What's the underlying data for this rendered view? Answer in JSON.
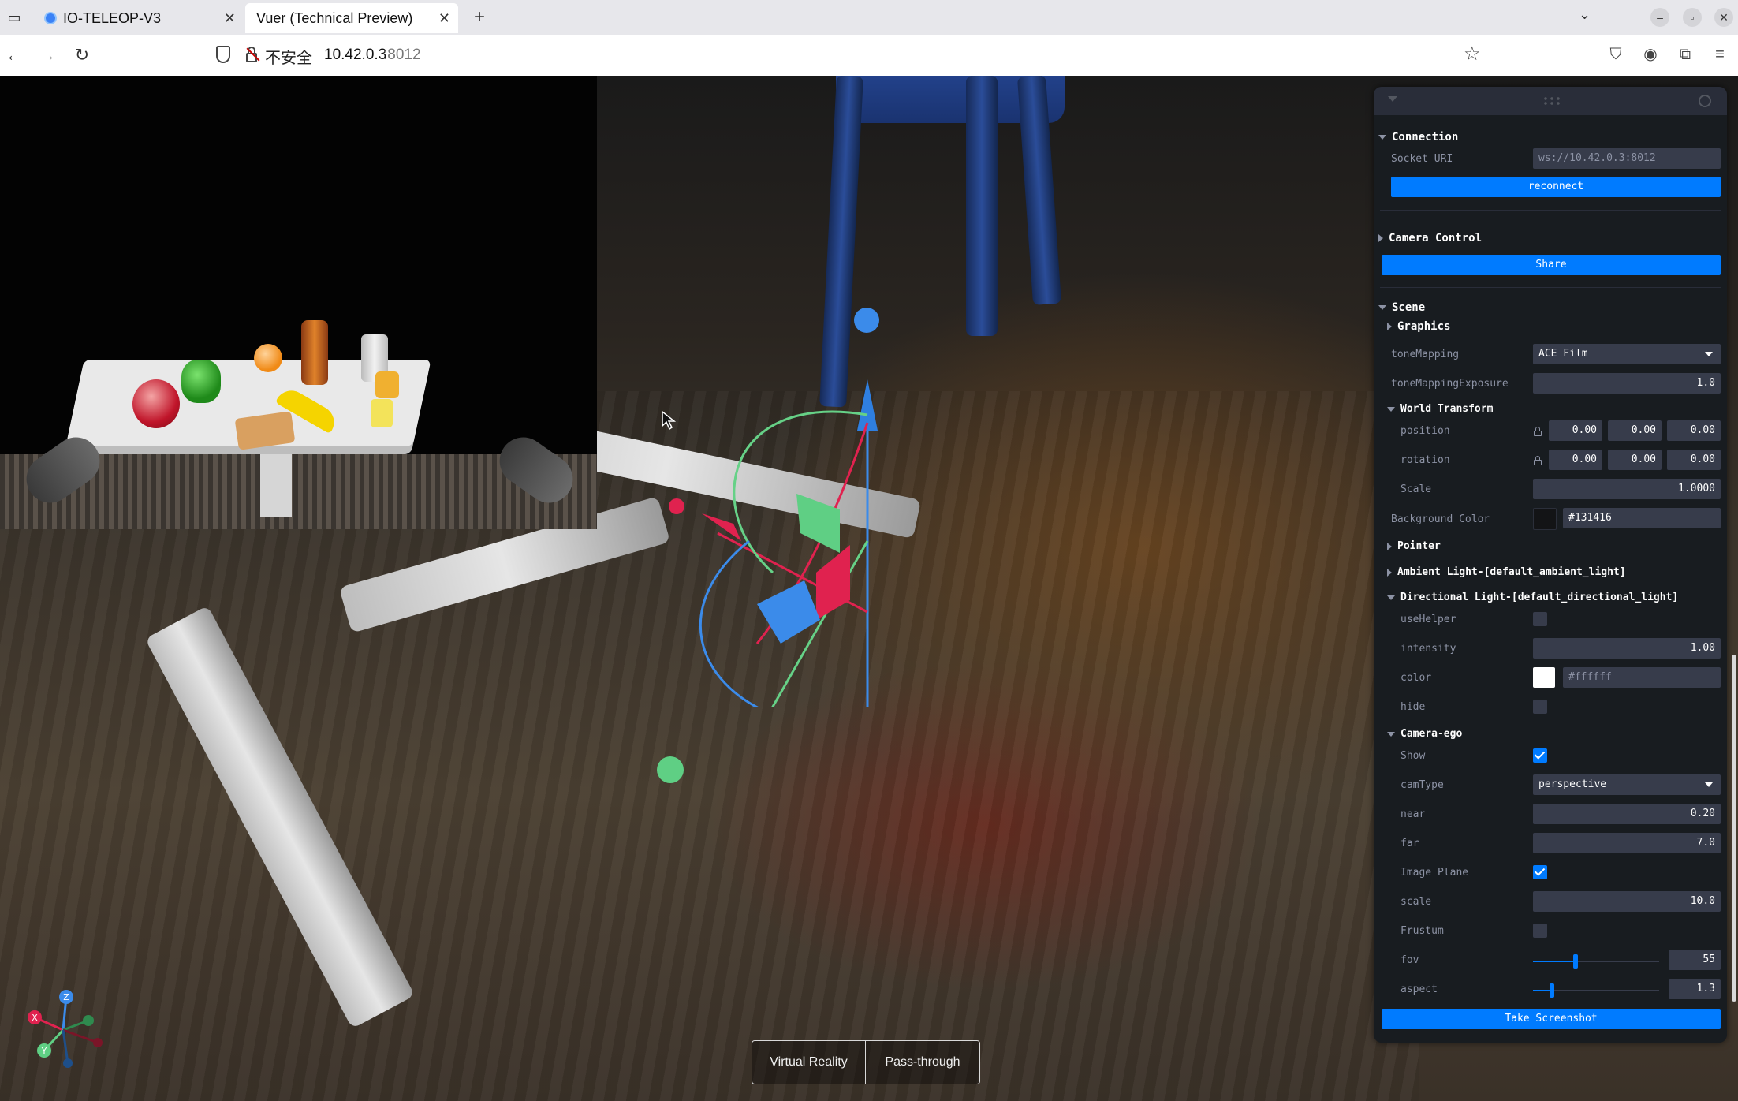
{
  "browser": {
    "tabs": [
      {
        "title": "IO-TELEOP-V3",
        "active": false
      },
      {
        "title": "Vuer (Technical Preview)",
        "active": true
      }
    ],
    "new_tab": "+",
    "address": {
      "security_label": "不安全",
      "host": "10.42.0.3",
      "port": ":8012"
    }
  },
  "viewport": {
    "mode_buttons": [
      "Virtual Reality",
      "Pass-through"
    ],
    "axes": {
      "x": "X",
      "y": "Y",
      "z": "Z"
    }
  },
  "panel": {
    "connection": {
      "title": "Connection",
      "socket_label": "Socket URI",
      "socket_value": "ws://10.42.0.3:8012",
      "reconnect_label": "reconnect"
    },
    "camera_control": {
      "title": "Camera Control",
      "share_label": "Share"
    },
    "scene": {
      "title": "Scene",
      "graphics": "Graphics",
      "tone_mapping_label": "toneMapping",
      "tone_mapping_value": "ACE Film",
      "exposure_label": "toneMappingExposure",
      "exposure_value": "1.0",
      "world_transform": {
        "title": "World Transform",
        "position_label": "position",
        "position": [
          "0.00",
          "0.00",
          "0.00"
        ],
        "rotation_label": "rotation",
        "rotation": [
          "0.00",
          "0.00",
          "0.00"
        ],
        "scale_label": "Scale",
        "scale_value": "1.0000"
      },
      "background_label": "Background Color",
      "background_value": "#131416",
      "background_color": "#131416",
      "pointer": "Pointer",
      "ambient_light": "Ambient Light-[default_ambient_light]",
      "directional_light": {
        "title": "Directional Light-[default_directional_light]",
        "use_helper_label": "useHelper",
        "use_helper": false,
        "intensity_label": "intensity",
        "intensity_value": "1.00",
        "color_label": "color",
        "color_value": "#ffffff",
        "color_swatch": "#ffffff",
        "hide_label": "hide",
        "hide": false
      },
      "camera_ego": {
        "title": "Camera-ego",
        "show_label": "Show",
        "show": true,
        "cam_type_label": "camType",
        "cam_type_value": "perspective",
        "near_label": "near",
        "near_value": "0.20",
        "far_label": "far",
        "far_value": "7.0",
        "image_plane_label": "Image Plane",
        "image_plane": true,
        "scale_label": "scale",
        "scale_value": "10.0",
        "frustum_label": "Frustum",
        "frustum": false,
        "fov_label": "fov",
        "fov_value": "55",
        "aspect_label": "aspect",
        "aspect_value": "1.3"
      }
    },
    "screenshot_label": "Take Screenshot"
  },
  "colors": {
    "accent": "#007bff",
    "panel_bg": "#181c20",
    "field_bg": "#373c4b"
  }
}
